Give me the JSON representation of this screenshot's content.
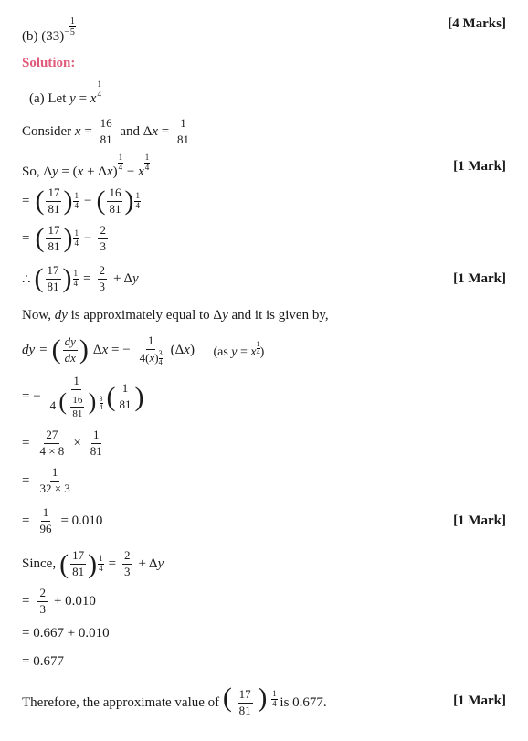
{
  "part_b": {
    "label": "(b) (33)",
    "exponent": "-1/5",
    "marks": "[4 Marks]"
  },
  "solution": {
    "label": "Solution:",
    "part_a": "(a) Let y = x",
    "part_a_exp": "1/4"
  }
}
